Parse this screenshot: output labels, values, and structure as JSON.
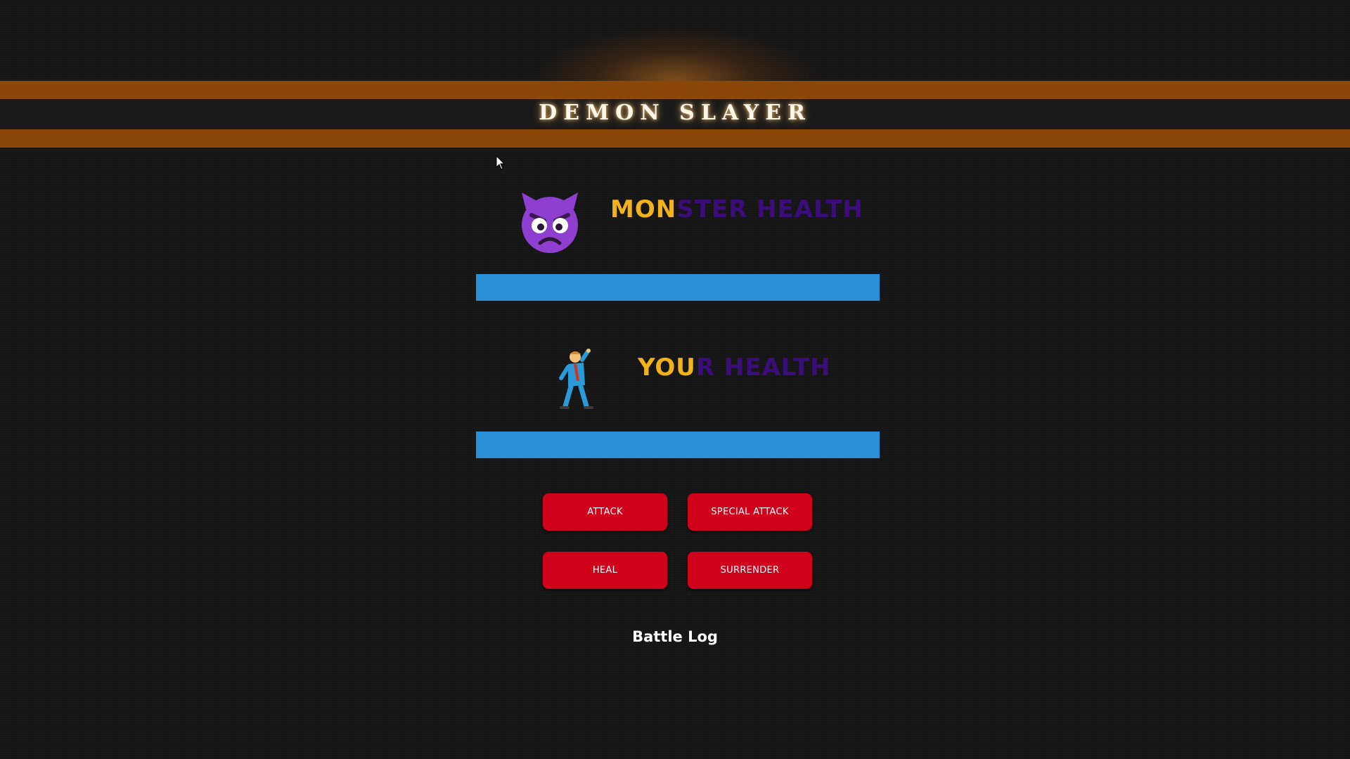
{
  "header": {
    "title": "DEMON SLAYER"
  },
  "monster": {
    "icon": "angry-devil-face-icon",
    "label_lit": "MON",
    "label_dim": "STER HEALTH",
    "health_percent": 100
  },
  "player": {
    "icon": "dancing-man-icon",
    "label_lit": "YOU",
    "label_dim": "R HEALTH",
    "health_percent": 100
  },
  "actions": {
    "attack_label": "ATTACK",
    "special_attack_label": "SPECIAL ATTACK",
    "heal_label": "HEAL",
    "surrender_label": "SURRENDER"
  },
  "battle_log": {
    "title": "Battle Log"
  },
  "colors": {
    "stripe": "#8a4707",
    "health_bar": "#2b8fd6",
    "button": "#d0021b",
    "label_lit": "#f2b21c",
    "label_dim": "#3b0d7a"
  }
}
